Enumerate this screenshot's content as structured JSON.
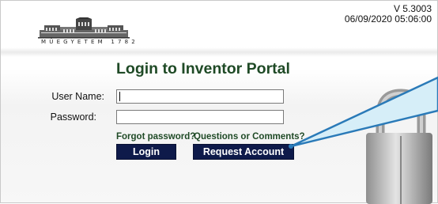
{
  "header": {
    "logo_text": "MŰEGYETEM 1782",
    "version": "V 5.3003",
    "datetime": "06/09/2020 05:06:00"
  },
  "login": {
    "title": "Login to Inventor Portal",
    "username_label": "User Name:",
    "password_label": "Password:",
    "username_value": "",
    "password_value": ""
  },
  "links": {
    "forgot_password": "Forgot password?",
    "questions": "Questions or Comments?"
  },
  "buttons": {
    "login": "Login",
    "request_account": "Request Account"
  },
  "colors": {
    "title_green": "#1f4a26",
    "button_navy": "#0e1a4a",
    "callout_blue": "#2a7ab8"
  },
  "icons": [
    "building-logo-icon",
    "padlock-icon",
    "callout-pointer-icon"
  ]
}
